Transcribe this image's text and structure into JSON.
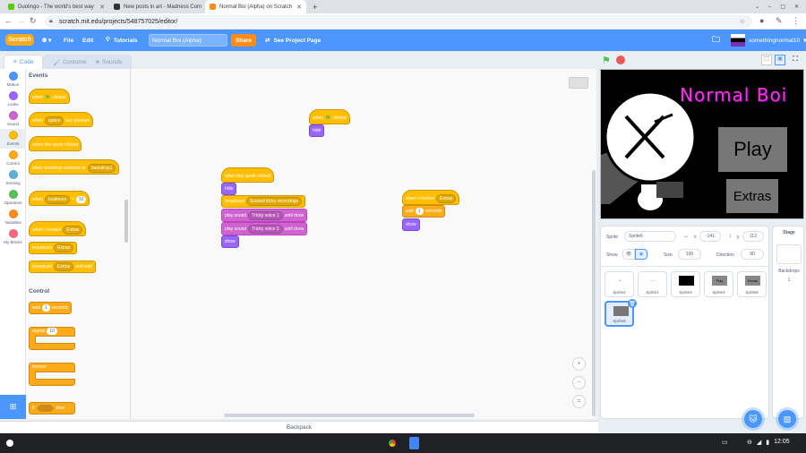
{
  "browser": {
    "tabs": [
      {
        "title": "Duolingo - The world's best way",
        "favicon_color": "#58cc02"
      },
      {
        "title": "New posts in art - Madness Com",
        "favicon_color": "#333333"
      },
      {
        "title": "Normal Boi (Alpha) on Scratch",
        "favicon_color": "#ff8c1a"
      }
    ],
    "new_tab": "+",
    "url": "scratch.mit.edu/projects/548757025/editor/"
  },
  "menubar": {
    "logo": "Scratch",
    "file": "File",
    "edit": "Edit",
    "tutorials": "Tutorials",
    "project_title": "Normal Boi (Alpha)",
    "share": "Share",
    "see_project_page": "See Project Page",
    "username": "somethingnormal10"
  },
  "editor_tabs": {
    "code": "Code",
    "costumes": "Costumes",
    "sounds": "Sounds"
  },
  "categories": [
    {
      "label": "Motion",
      "color": "#4c97ff"
    },
    {
      "label": "Looks",
      "color": "#9966ff"
    },
    {
      "label": "Sound",
      "color": "#cf63cf"
    },
    {
      "label": "Events",
      "color": "#ffbf00"
    },
    {
      "label": "Control",
      "color": "#ffab19"
    },
    {
      "label": "Sensing",
      "color": "#5cb1d6"
    },
    {
      "label": "Operators",
      "color": "#59c059"
    },
    {
      "label": "Variables",
      "color": "#ff8c1a"
    },
    {
      "label": "My Blocks",
      "color": "#ff6680"
    }
  ],
  "palette": {
    "events_heading": "Events",
    "when_flag_a": "when",
    "when_flag_b": "clicked",
    "when_key_a": "when",
    "when_key_val": "space",
    "when_key_b": "key pressed",
    "when_sprite_clicked": "when this sprite clicked",
    "when_backdrop_a": "when backdrop switches to",
    "when_backdrop_val": "backdrop1",
    "when_loudness_a": "when",
    "when_loudness_val": "loudness",
    "when_loudness_gt": ">",
    "when_loudness_num": "10",
    "when_receive_a": "when I receive",
    "when_receive_val": "Extras",
    "broadcast_a": "broadcast",
    "broadcast_val": "Extras",
    "broadcast_wait_a": "broadcast",
    "broadcast_wait_val": "Extras",
    "broadcast_wait_b": "and wait",
    "control_heading": "Control",
    "wait_a": "wait",
    "wait_num": "1",
    "wait_b": "seconds",
    "repeat_a": "repeat",
    "repeat_num": "10",
    "forever": "forever",
    "if_a": "if",
    "if_b": "then"
  },
  "scripts": {
    "s1_hat_a": "when",
    "s1_hat_b": "clicked",
    "s1_hide": "hide",
    "s2_hat": "when this sprite clicked",
    "s2_hide": "hide",
    "s2_broadcast": "broadcast",
    "s2_broadcast_val": "Sussed kicky recordings",
    "s2_play1": "play sound",
    "s2_play1_val": "Tricky voice 1",
    "s2_play1_b": "until done",
    "s2_play2": "play sound",
    "s2_play2_val": "Tricky voice 2",
    "s2_play2_b": "until done",
    "s2_show": "show",
    "s3_hat": "when I receive",
    "s3_hat_val": "Extras",
    "s3_wait": "wait",
    "s3_wait_num": "1",
    "s3_wait_b": "seconds",
    "s3_show": "show"
  },
  "zoom": {
    "in": "+",
    "out": "−",
    "reset": "="
  },
  "backpack": "Backpack",
  "stage": {
    "title_text": "Normal Boi",
    "play_text": "Play",
    "extras_text": "Extras"
  },
  "sprite_info": {
    "sprite_label": "Sprite",
    "sprite_name": "Sprite6",
    "x_label": "x",
    "x_value": "-141",
    "y_label": "y",
    "y_value": "112",
    "show_label": "Show",
    "size_label": "Size",
    "size_value": "100",
    "direction_label": "Direction",
    "direction_value": "90"
  },
  "sprites": [
    {
      "name": "Sprite2",
      "thumb": ""
    },
    {
      "name": "Sprite1",
      "thumb": ""
    },
    {
      "name": "Sprite3",
      "thumb": ""
    },
    {
      "name": "Sprite4",
      "thumb": "Play"
    },
    {
      "name": "Sprite5",
      "thumb": "Extras"
    },
    {
      "name": "Sprite6",
      "thumb": ""
    }
  ],
  "stage_panel": {
    "title": "Stage",
    "backdrops_label": "Backdrops",
    "backdrops_count": "1"
  },
  "taskbar": {
    "time": "12:05"
  },
  "accent": "#4c97ff"
}
